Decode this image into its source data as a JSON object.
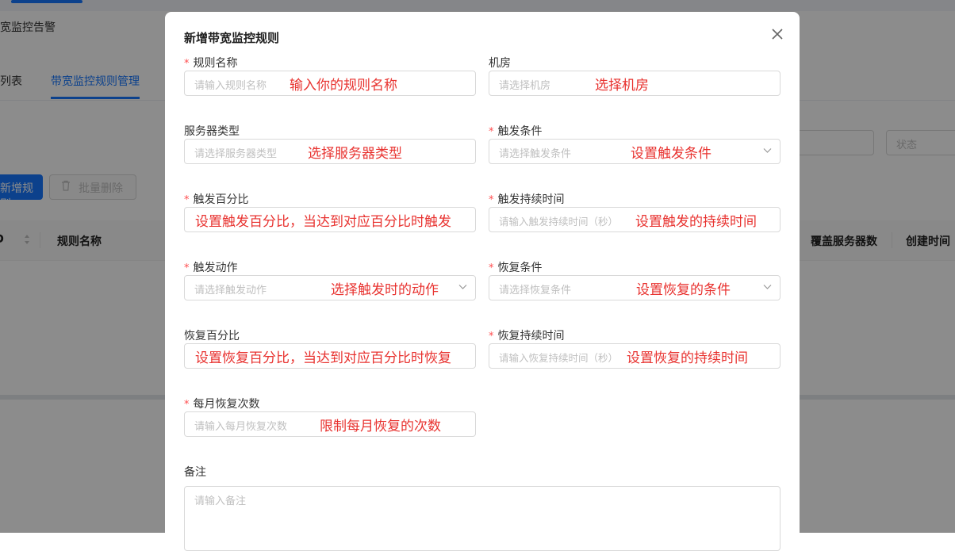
{
  "background": {
    "breadcrumb": "带宽监控告警",
    "tabs": [
      "告警列表",
      "带宽监控规则管理"
    ],
    "status_filter_placeholder": "状态",
    "add_rule_button": "新增规则",
    "batch_delete_button": "批量删除",
    "table_columns": [
      "ID",
      "规则名称",
      "覆盖服务器数",
      "创建时间"
    ],
    "colors": {
      "primary": "#1677ff"
    }
  },
  "modal": {
    "title": "新增带宽监控规则",
    "close_icon": "close-icon",
    "fields": {
      "rule_name": {
        "label": "规则名称",
        "required": true,
        "placeholder": "请输入规则名称",
        "annotation": "输入你的规则名称"
      },
      "machine_room": {
        "label": "机房",
        "required": false,
        "placeholder": "请选择机房",
        "annotation": "选择机房"
      },
      "server_type": {
        "label": "服务器类型",
        "required": false,
        "placeholder": "请选择服务器类型",
        "annotation": "选择服务器类型"
      },
      "trigger_condition": {
        "label": "触发条件",
        "required": true,
        "placeholder": "请选择触发条件",
        "annotation": "设置触发条件"
      },
      "trigger_percent": {
        "label": "触发百分比",
        "required": true,
        "placeholder": "",
        "annotation": "设置触发百分比，当达到对应百分比时触发"
      },
      "trigger_duration": {
        "label": "触发持续时间",
        "required": true,
        "placeholder": "请输入触发持续时间（秒）",
        "annotation": "设置触发的持续时间"
      },
      "trigger_action": {
        "label": "触发动作",
        "required": true,
        "placeholder": "请选择触发动作",
        "annotation": "选择触发时的动作"
      },
      "recovery_condition": {
        "label": "恢复条件",
        "required": true,
        "placeholder": "请选择恢复条件",
        "annotation": "设置恢复的条件"
      },
      "recovery_percent": {
        "label": "恢复百分比",
        "required": false,
        "placeholder": "",
        "annotation": "设置恢复百分比，当达到对应百分比时恢复"
      },
      "recovery_duration": {
        "label": "恢复持续时间",
        "required": true,
        "placeholder": "请输入恢复持续时间（秒）",
        "annotation": "设置恢复的持续时间"
      },
      "monthly_recovery_count": {
        "label": "每月恢复次数",
        "required": true,
        "placeholder": "请输入每月恢复次数",
        "annotation": "限制每月恢复的次数"
      },
      "remark": {
        "label": "备注",
        "required": false,
        "placeholder": "请输入备注"
      }
    },
    "required_marker": "*",
    "annotation_color": "#e8322f"
  }
}
